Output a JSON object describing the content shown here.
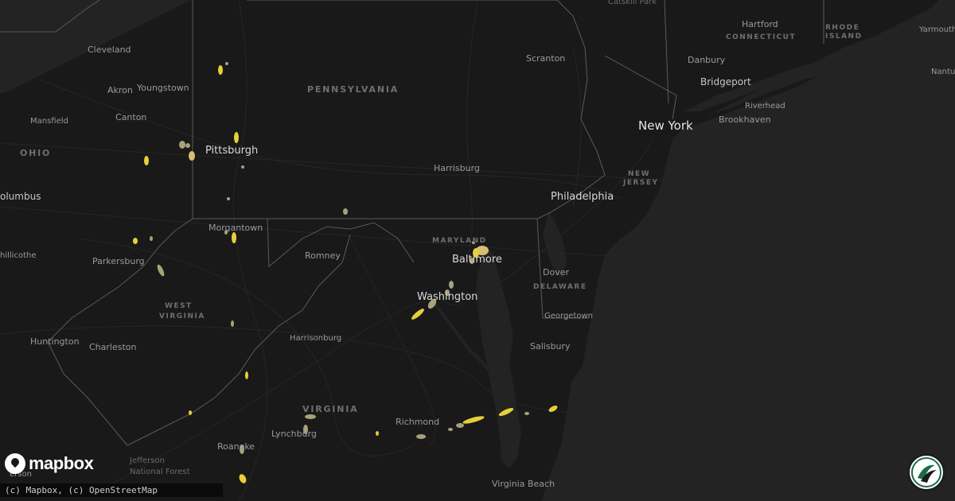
{
  "map": {
    "colors": {
      "land": "#191919",
      "water": "#232323",
      "border": "#5a5a5a",
      "road": "#2a2a2a",
      "swath_light": "#a8a27a",
      "swath_yellow": "#e6cf3a"
    },
    "labels": {
      "catskill": "Catskill Park",
      "hartford": "Hartford",
      "connecticut": "CONNECTICUT",
      "rhode_island_1": "RHODE",
      "rhode_island_2": "ISLAND",
      "yarmouth": "Yarmouth",
      "nantucket": "Nantuc",
      "cleveland": "Cleveland",
      "youngstown": "Youngstown",
      "akron": "Akron",
      "pennsylvania": "PENNSYLVANIA",
      "scranton": "Scranton",
      "danbury": "Danbury",
      "bridgeport": "Bridgeport",
      "riverhead": "Riverhead",
      "brookhaven": "Brookhaven",
      "new_york": "New York",
      "mansfield": "Mansfield",
      "canton": "Canton",
      "ohio": "OHIO",
      "pittsburgh": "Pittsburgh",
      "harrisburg": "Harrisburg",
      "new_jersey_1": "NEW",
      "new_jersey_2": "JERSEY",
      "columbus": "olumbus",
      "philadelphia": "Philadelphia",
      "morgantown": "Morgantown",
      "maryland": "MARYLAND",
      "chillicothe": "hillicothe",
      "romney": "Romney",
      "baltimore": "Baltimore",
      "parkersburg": "Parkersburg",
      "dover": "Dover",
      "delaware": "DELAWARE",
      "washington": "Washington",
      "west_virginia_1": "WEST",
      "west_virginia_2": "VIRGINIA",
      "georgetown": "Georgetown",
      "harrisonburg": "Harrisonburg",
      "huntington": "Huntington",
      "charleston": "Charleston",
      "salisbury": "Salisbury",
      "virginia": "VIRGINIA",
      "richmond": "Richmond",
      "lynchburg": "Lynchburg",
      "roanoke": "Roanoke",
      "jefferson_1": "Jefferson",
      "jefferson_2": "National Forest",
      "jefferson_3": "erson",
      "virginia_beach": "Virginia Beach"
    },
    "hail_swath_icons": "hail-swath-icon"
  },
  "logo": {
    "wordmark": "mapbox",
    "icon": "mapbox-logo-icon"
  },
  "attribution": {
    "text": "(c) Mapbox, (c) OpenStreetMap"
  },
  "badge": {
    "icon": "brand-badge-icon"
  }
}
